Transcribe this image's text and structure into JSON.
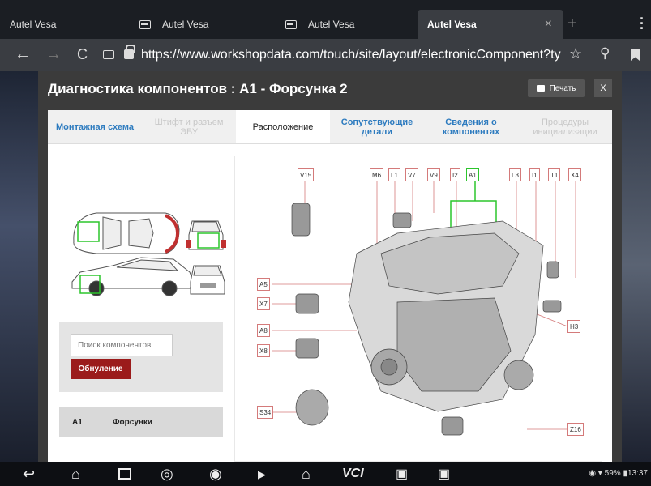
{
  "browser": {
    "tabs": [
      {
        "label": "Autel Vesa",
        "active": false
      },
      {
        "label": "Autel Vesa",
        "active": false
      },
      {
        "label": "Autel Vesa",
        "active": false
      },
      {
        "label": "Autel Vesa",
        "active": true
      }
    ],
    "new_tab": "+",
    "close": "×",
    "url": "https://www.workshopdata.com/touch/site/layout/electronicComponent?ty"
  },
  "panel": {
    "title": "Диагностика компонентов : А1 - Форсунка 2",
    "print_label": "Печать",
    "close_label": "X"
  },
  "tabs": [
    {
      "label": "Монтажная схема",
      "state": "link"
    },
    {
      "label": "Штифт и разъем ЭБУ",
      "state": "disabled"
    },
    {
      "label": "Расположение",
      "state": "active"
    },
    {
      "label": "Сопутствующие детали",
      "state": "link"
    },
    {
      "label": "Сведения о компонентах",
      "state": "link"
    },
    {
      "label": "Процедуры инициализации",
      "state": "disabled"
    }
  ],
  "search": {
    "placeholder": "Поиск компонентов",
    "reset_label": "Обнуление"
  },
  "component": {
    "code": "A1",
    "name": "Форсунки"
  },
  "diagram_labels": {
    "top": [
      "V15",
      "M6",
      "L1",
      "V7",
      "V9",
      "I2",
      "A1",
      "L3",
      "I1",
      "T1",
      "X4"
    ],
    "left": [
      "A5",
      "X7",
      "A8",
      "X8",
      "S34"
    ],
    "right": [
      "H3",
      "Z16"
    ]
  },
  "status_bar": {
    "battery": "59%",
    "time": "13:37"
  },
  "colors": {
    "accent_red": "#9b1b1b",
    "link_blue": "#2d7bbf",
    "highlight_green": "#2cc52c"
  }
}
